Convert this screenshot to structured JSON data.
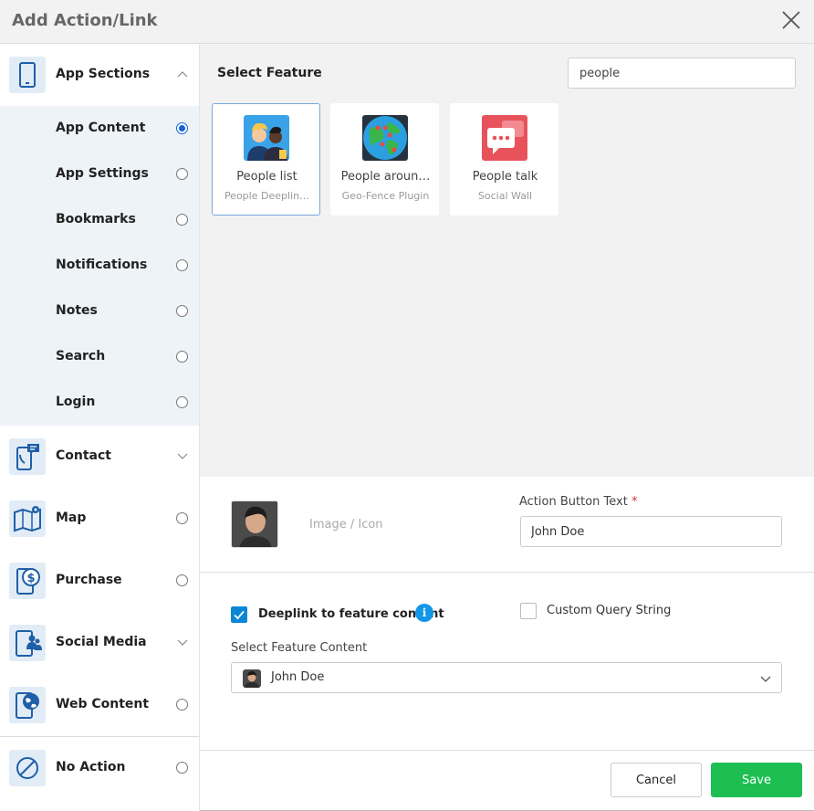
{
  "header": {
    "title": "Add Action/Link"
  },
  "sidebar": {
    "sections": [
      {
        "label": "App Sections",
        "icon": "mobile-phone-icon",
        "control": "chevron-up"
      },
      {
        "label": "Contact",
        "icon": "phone-chat-icon",
        "control": "chevron-down"
      },
      {
        "label": "Map",
        "icon": "map-pin-icon",
        "control": "radio"
      },
      {
        "label": "Purchase",
        "icon": "dollar-coin-icon",
        "control": "radio"
      },
      {
        "label": "Social Media",
        "icon": "people-group-icon",
        "control": "chevron-down"
      },
      {
        "label": "Web Content",
        "icon": "globe-icon",
        "control": "radio"
      },
      {
        "label": "No Action",
        "icon": "no-symbol-icon",
        "control": "radio"
      }
    ],
    "app_sections_items": [
      {
        "label": "App Content",
        "selected": true
      },
      {
        "label": "App Settings",
        "selected": false
      },
      {
        "label": "Bookmarks",
        "selected": false
      },
      {
        "label": "Notifications",
        "selected": false
      },
      {
        "label": "Notes",
        "selected": false
      },
      {
        "label": "Search",
        "selected": false
      },
      {
        "label": "Login",
        "selected": false
      }
    ]
  },
  "main": {
    "select_feature_label": "Select Feature",
    "search": {
      "value": "people"
    },
    "features": [
      {
        "name": "People list",
        "sub": "People Deeplin…",
        "icon": "people-list-icon",
        "selected": true
      },
      {
        "name": "People aroun…",
        "sub": "Geo-Fence Plugin",
        "icon": "globe-map-icon",
        "selected": false
      },
      {
        "name": "People talk",
        "sub": "Social Wall",
        "icon": "chat-bubbles-icon",
        "selected": false
      }
    ]
  },
  "form": {
    "image_label": "Image / Icon",
    "action_button_text_label": "Action Button Text",
    "required_marker": "*",
    "action_button_text_value": "John Doe",
    "deeplink_label": "Deeplink to feature content",
    "deeplink_checked": true,
    "info_glyph": "i",
    "custom_query_label": "Custom Query String",
    "custom_query_checked": false,
    "select_feature_content_label": "Select Feature Content",
    "select_feature_content_value": "John Doe"
  },
  "footer": {
    "cancel_label": "Cancel",
    "save_label": "Save"
  },
  "colors": {
    "accent_blue": "#1565d8",
    "save_green": "#1dbf52",
    "checkbox_blue": "#0b86d6",
    "sidebar_highlight": "#eef3f8"
  }
}
